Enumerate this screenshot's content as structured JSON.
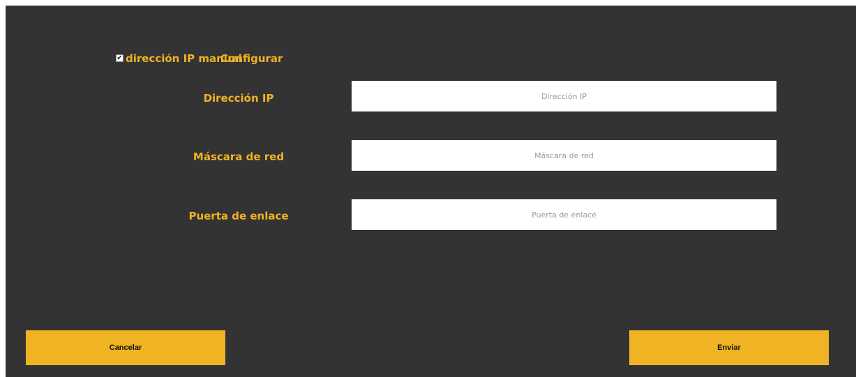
{
  "manual_ip": {
    "checkbox_glyph": "✔",
    "checked": true,
    "label": "dirección IP manual",
    "configure_label": "Configurar"
  },
  "fields": [
    {
      "label": "Dirección IP",
      "placeholder": "Dirección IP",
      "value": ""
    },
    {
      "label": "Máscara de red",
      "placeholder": "Máscara de red",
      "value": ""
    },
    {
      "label": "Puerta de enlace",
      "placeholder": "Puerta de enlace",
      "value": ""
    }
  ],
  "buttons": {
    "cancel_label": "Cancelar",
    "send_label": "Enviar"
  },
  "colors": {
    "background": "#333333",
    "accent": "#f0b323",
    "input_bg": "#ffffff"
  }
}
